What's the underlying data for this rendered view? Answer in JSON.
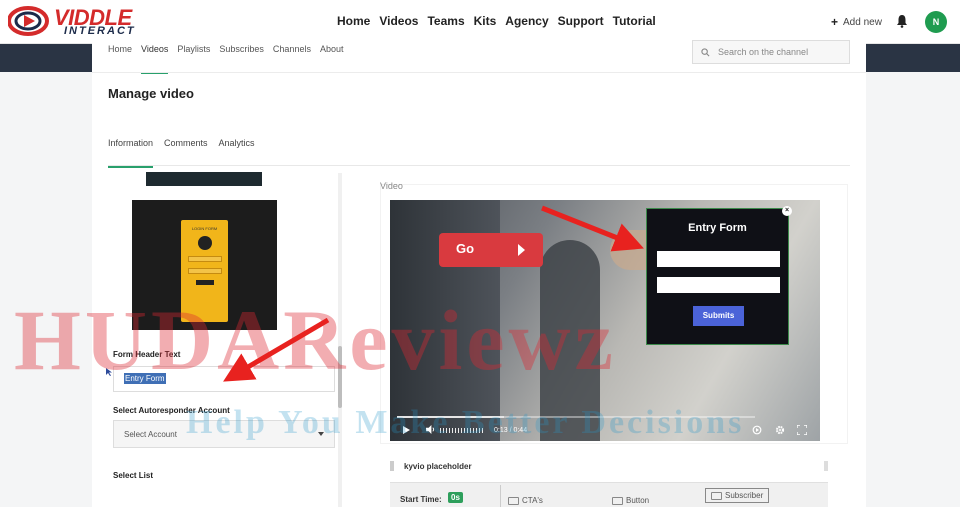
{
  "brand": {
    "name_top": "VIDDLE",
    "name_bottom": "INTERACT",
    "color": "#d42b2b"
  },
  "topnav": {
    "links": [
      "Home",
      "Videos",
      "Teams",
      "Kits",
      "Agency",
      "Support",
      "Tutorial"
    ],
    "add_new": "Add new",
    "avatar_initial": "N"
  },
  "channel_tabs": [
    "Home",
    "Videos",
    "Playlists",
    "Subscribes",
    "Channels",
    "About"
  ],
  "channel_active_tab": "Videos",
  "search": {
    "placeholder": "Search on the channel"
  },
  "page_title": "Manage video",
  "sub_tabs": [
    "Information",
    "Comments",
    "Analytics"
  ],
  "sub_active_tab": "Information",
  "login_thumb": {
    "label": "LOGIN FORM"
  },
  "form": {
    "header_label": "Form Header Text",
    "header_value": "Entry Form",
    "autoresponder_label": "Select Autoresponder Account",
    "autoresponder_value": "Select Account",
    "list_label": "Select List"
  },
  "video_section": {
    "label": "Video",
    "go_button": "Go",
    "entry_form_title": "Entry Form",
    "submit_label": "Submits",
    "time": "0:13 / 0:44",
    "progress": 0.3
  },
  "placeholder_row": {
    "label": "kyvio placeholder"
  },
  "bottom_bar": {
    "start_time_label": "Start Time:",
    "start_time_value": "0s",
    "options": [
      "CTA's",
      "Button",
      "Subscriber"
    ]
  },
  "watermark": {
    "big": "HUDAReviewz",
    "small": "Help You Make Better Decisions"
  },
  "colors": {
    "accent_green": "#28a06c",
    "avatar_green": "#1f9c50",
    "go_red": "#d93a3f",
    "submit_blue": "#4b63d8"
  }
}
